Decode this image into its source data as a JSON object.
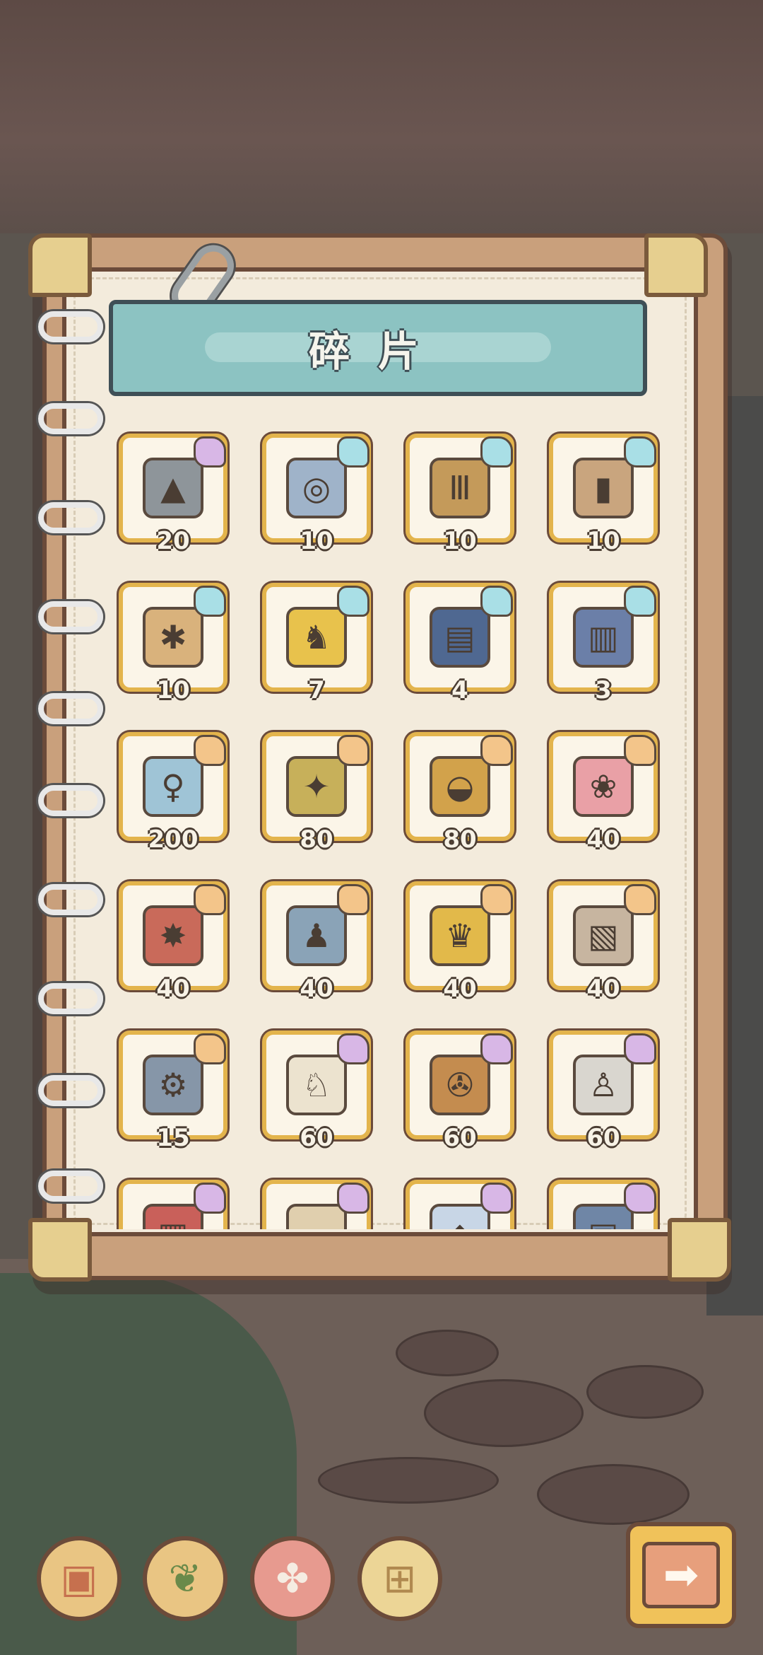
{
  "title": "碎片",
  "colors": {
    "card_border": "#e3b44c",
    "badge_blue": "#a9dfe6",
    "badge_orange": "#f3c58a",
    "badge_purple": "#d8b7e6"
  },
  "fragments": [
    {
      "count": "20",
      "badge": "purple",
      "icon": "stone-tablet-icon",
      "glyph": "▲",
      "art_color": "#8e959a"
    },
    {
      "count": "10",
      "badge": "blue",
      "icon": "astrolabe-icon",
      "glyph": "◎",
      "art_color": "#9fb3c9"
    },
    {
      "count": "10",
      "badge": "blue",
      "icon": "loom-icon",
      "glyph": "Ⅲ",
      "art_color": "#c49a5a"
    },
    {
      "count": "10",
      "badge": "blue",
      "icon": "vacuum-tubes-icon",
      "glyph": "▮",
      "art_color": "#c9a57e"
    },
    {
      "count": "10",
      "badge": "blue",
      "icon": "beetle-board-icon",
      "glyph": "✱",
      "art_color": "#d9b27c"
    },
    {
      "count": "7",
      "badge": "blue",
      "icon": "golden-phoenix-icon",
      "glyph": "♞",
      "art_color": "#e8c24c"
    },
    {
      "count": "4",
      "badge": "blue",
      "icon": "ancient-book-icon",
      "glyph": "▤",
      "art_color": "#4f6891"
    },
    {
      "count": "3",
      "badge": "blue",
      "icon": "blue-book-icon",
      "glyph": "▥",
      "art_color": "#6b7fa8"
    },
    {
      "count": "200",
      "badge": "orange",
      "icon": "genji-book-icon",
      "glyph": "♀",
      "art_color": "#9fc4d6"
    },
    {
      "count": "80",
      "badge": "orange",
      "icon": "scarab-beetle-icon",
      "glyph": "✦",
      "art_color": "#c7b05a"
    },
    {
      "count": "80",
      "badge": "orange",
      "icon": "basket-icon",
      "glyph": "◒",
      "art_color": "#d2a24b"
    },
    {
      "count": "40",
      "badge": "orange",
      "icon": "brain-icon",
      "glyph": "❀",
      "art_color": "#e9a0a6"
    },
    {
      "count": "40",
      "badge": "orange",
      "icon": "red-machine-icon",
      "glyph": "✸",
      "art_color": "#c96a5a"
    },
    {
      "count": "40",
      "badge": "orange",
      "icon": "bearded-figure-icon",
      "glyph": "♟",
      "art_color": "#8aa3b7"
    },
    {
      "count": "40",
      "badge": "orange",
      "icon": "pharaoh-mask-icon",
      "glyph": "♛",
      "art_color": "#e2b94a"
    },
    {
      "count": "40",
      "badge": "orange",
      "icon": "scroll-book-icon",
      "glyph": "▧",
      "art_color": "#c7b5a0"
    },
    {
      "count": "15",
      "badge": "orange",
      "icon": "robot-parts-icon",
      "glyph": "⚙",
      "art_color": "#8696a8"
    },
    {
      "count": "60",
      "badge": "purple",
      "icon": "white-sheep-icon",
      "glyph": "♘",
      "art_color": "#ece3cf"
    },
    {
      "count": "60",
      "badge": "purple",
      "icon": "spinning-wheel-icon",
      "glyph": "✇",
      "art_color": "#c48c4f"
    },
    {
      "count": "60",
      "badge": "purple",
      "icon": "statue-icon",
      "glyph": "♙",
      "art_color": "#d9d6cf"
    },
    {
      "count": "",
      "badge": "purple",
      "icon": "red-panel-icon",
      "glyph": "▦",
      "art_color": "#c9605a"
    },
    {
      "count": "",
      "badge": "purple",
      "icon": "open-book-icon",
      "glyph": "▭",
      "art_color": "#e0cfae"
    },
    {
      "count": "",
      "badge": "purple",
      "icon": "crystal-icon",
      "glyph": "◆",
      "art_color": "#c8d6e6"
    },
    {
      "count": "",
      "badge": "purple",
      "icon": "blue-box-icon",
      "glyph": "▣",
      "art_color": "#6f86a6"
    }
  ],
  "toolbar": [
    {
      "name": "backpack-button",
      "glyph": "▣",
      "bg": "#e9c583",
      "fg": "#c6704e"
    },
    {
      "name": "branch-button",
      "glyph": "❦",
      "bg": "#e9c583",
      "fg": "#6a8a4a"
    },
    {
      "name": "puzzle-button",
      "glyph": "✤",
      "bg": "#e79a8f",
      "fg": "#f5ece2"
    },
    {
      "name": "chest-button",
      "glyph": "⊞",
      "bg": "#ecd596",
      "fg": "#b0894f"
    }
  ],
  "next_glyph": "➡"
}
